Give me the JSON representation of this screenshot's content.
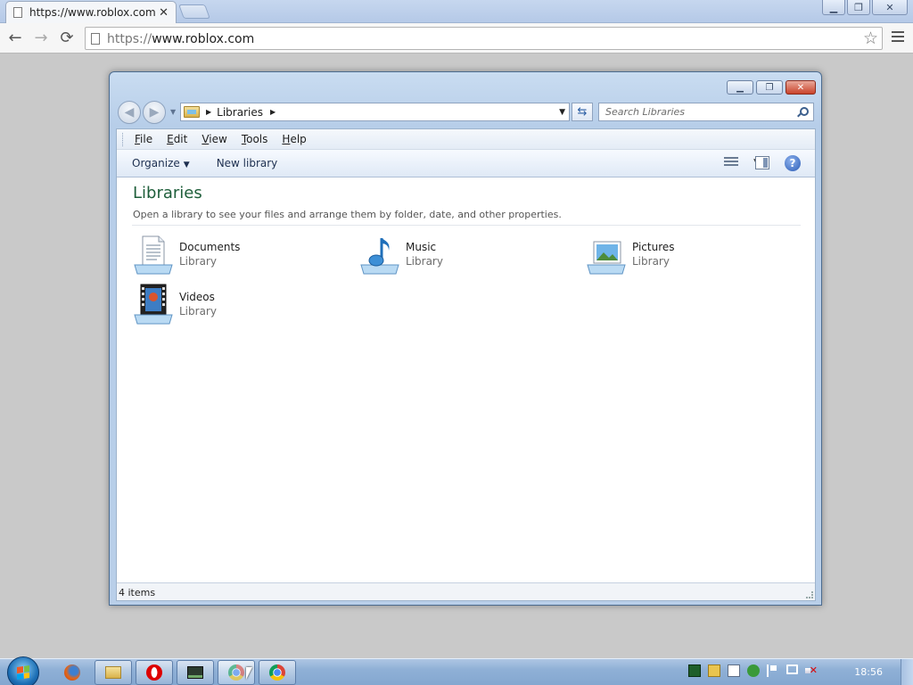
{
  "browser": {
    "tab_title": "https://www.roblox.com/",
    "tab_close": "✕",
    "url_scheme": "https://",
    "url_host": "www.roblox.com",
    "back_glyph": "←",
    "forward_glyph": "→",
    "reload_glyph": "⟳",
    "star_glyph": "☆",
    "minimize_glyph": "▁",
    "restore_glyph": "❐",
    "close_glyph": "✕"
  },
  "explorer": {
    "breadcrumb": "Libraries",
    "search_placeholder": "Search Libraries",
    "menu": [
      "File",
      "Edit",
      "View",
      "Tools",
      "Help"
    ],
    "commands": {
      "organize": "Organize",
      "new_library": "New library"
    },
    "help_glyph": "?",
    "title": "Libraries",
    "description": "Open a library to see your files and arrange them by folder, date, and other properties.",
    "libraries": [
      {
        "name": "Documents",
        "type": "Library",
        "icon": "documents-library-icon"
      },
      {
        "name": "Music",
        "type": "Library",
        "icon": "music-library-icon"
      },
      {
        "name": "Pictures",
        "type": "Library",
        "icon": "pictures-library-icon"
      },
      {
        "name": "Videos",
        "type": "Library",
        "icon": "videos-library-icon"
      }
    ],
    "status": "4 items"
  },
  "taskbar": {
    "clock": "18:56",
    "apps": [
      "firefox-icon",
      "explorer-icon",
      "opera-icon",
      "app-icon",
      "chrome-icon",
      "chrome-icon"
    ]
  },
  "colors": {
    "title_green": "#1e5e3a",
    "taskbar_blue": "#8fb0d6",
    "close_red": "#c9432b"
  }
}
